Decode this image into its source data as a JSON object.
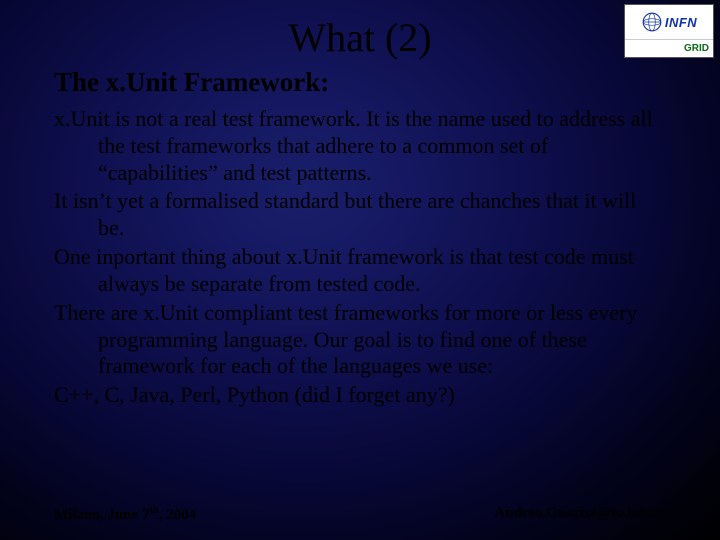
{
  "logo": {
    "top_text": "INFN",
    "bottom_text": "GRID"
  },
  "title": "What (2)",
  "subtitle": "The x.Unit Framework:",
  "paragraphs": [
    "x.Unit is not a real test framework. It is the name used to address all the test frameworks that adhere to a common set of “capabilities” and test patterns.",
    "It isn’t yet a formalised standard but there are chanches that it will be.",
    "One inportant thing about x.Unit framework is that test code must always be separate from tested code.",
    "There are x.Unit compliant test frameworks for more or less every programming language. Our goal is to find one of these framework for each of the languages we use:",
    "C++, C, Java, Perl, Python (did I forget any?)"
  ],
  "footer": {
    "left_prefix": "Milano, June 7",
    "left_suffix": ", 2004",
    "left_super": "th",
    "right": "Andrea.Guarise@to.infn.it"
  }
}
